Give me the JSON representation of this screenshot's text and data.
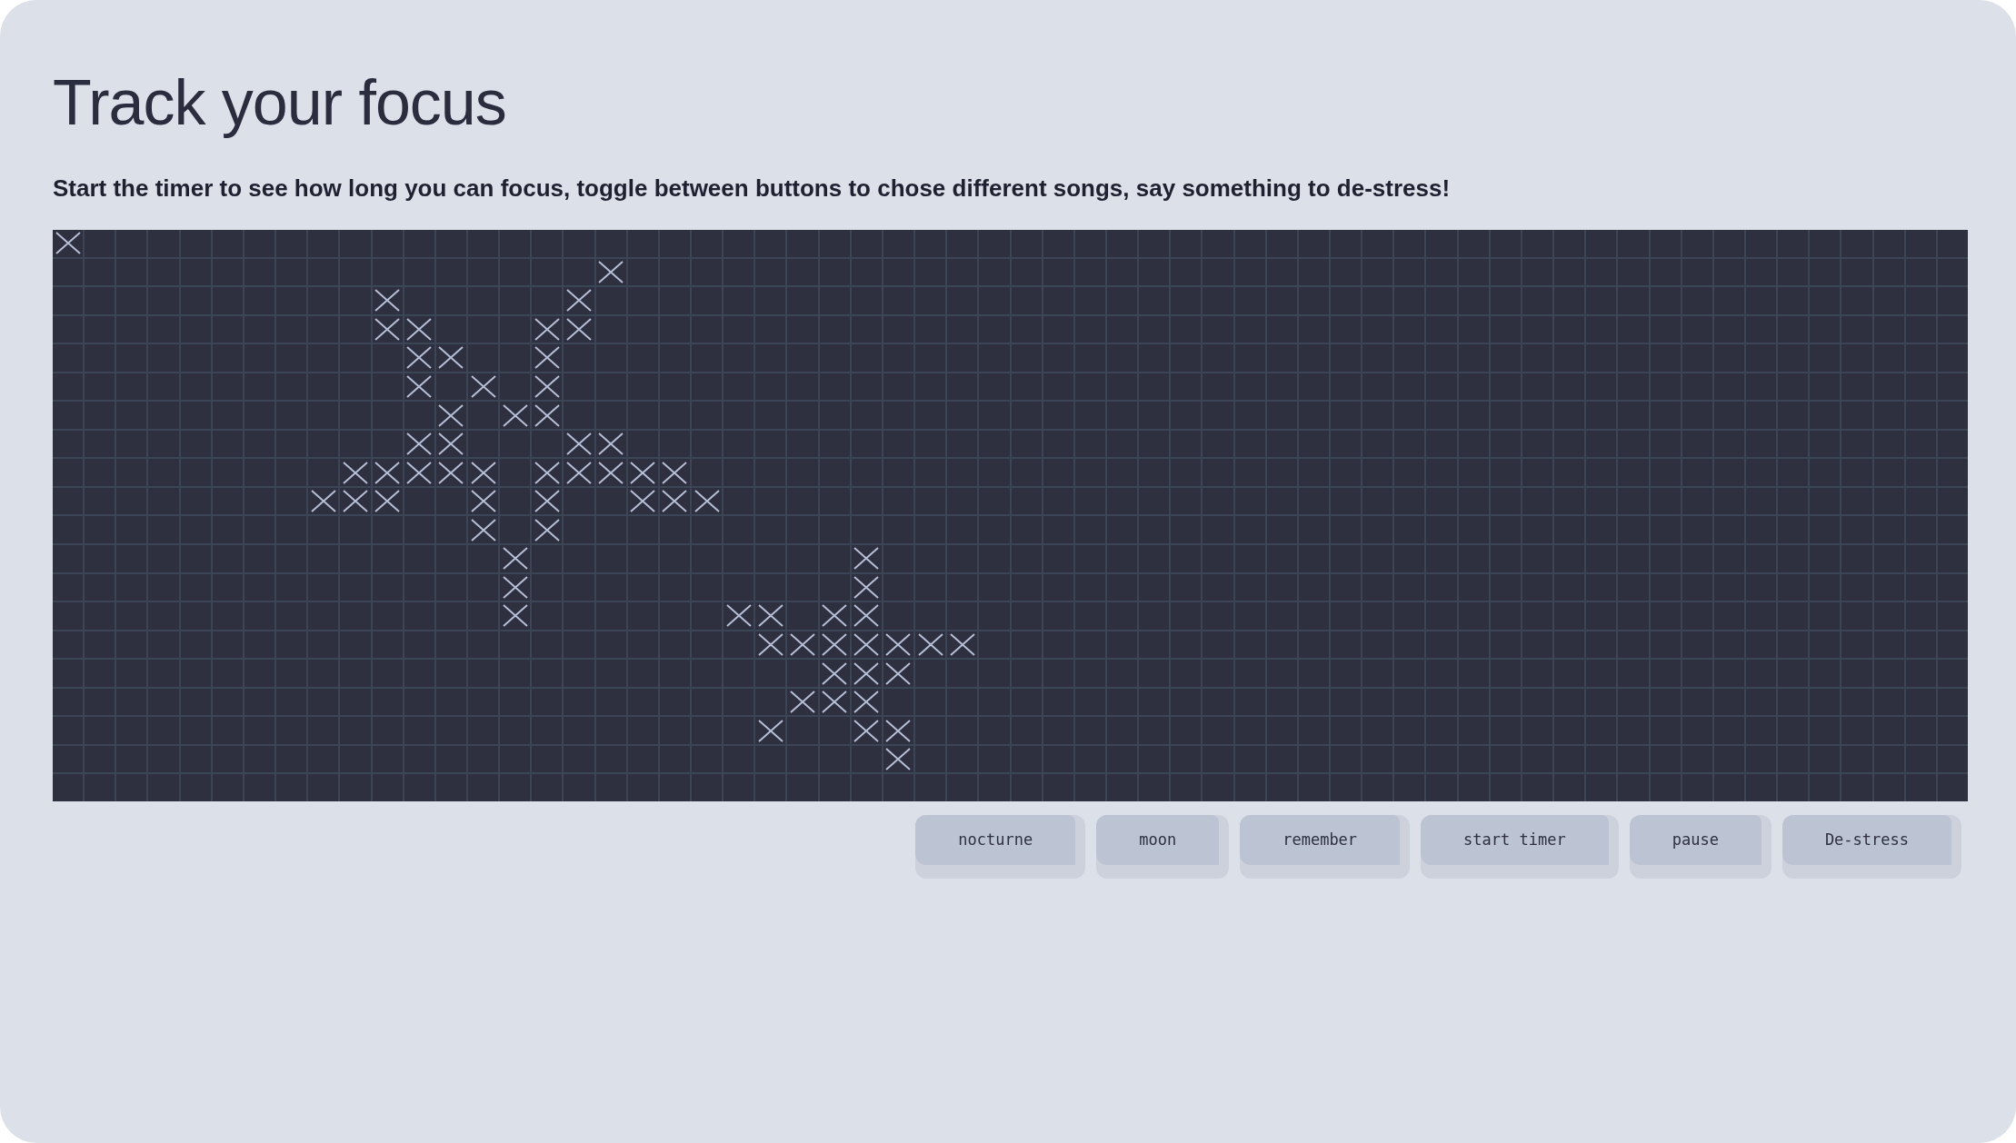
{
  "title": "Track your focus",
  "instructions": "Start the timer to see how long you can focus, toggle between buttons to chose different songs, say something to de-stress!",
  "grid": {
    "rows": [
      {
        "marked": [
          true,
          false,
          false,
          false,
          false,
          false,
          false,
          false,
          false,
          false,
          false,
          false,
          false,
          false,
          false,
          false,
          false,
          false,
          false,
          false,
          false,
          false,
          false,
          false,
          false,
          false,
          false,
          false,
          false,
          false,
          false,
          false,
          false,
          false,
          false,
          false,
          false,
          false,
          false,
          false,
          false,
          false,
          false,
          false,
          false,
          false,
          false,
          false,
          false,
          false,
          false,
          false,
          false,
          false,
          false,
          false,
          false,
          false,
          false,
          false
        ]
      },
      {
        "marked": [
          false,
          false,
          false,
          false,
          false,
          false,
          false,
          false,
          false,
          false,
          false,
          false,
          false,
          false,
          false,
          false,
          false,
          true,
          false,
          false,
          false,
          false,
          false,
          false,
          false,
          false,
          false,
          false,
          false,
          false,
          false,
          false,
          false,
          false,
          false,
          false,
          false,
          false,
          false,
          false,
          false,
          false,
          false,
          false,
          false,
          false,
          false,
          false,
          false,
          false,
          false,
          false,
          false,
          false,
          false,
          false,
          false,
          false,
          false,
          false
        ]
      },
      {
        "marked": [
          false,
          false,
          false,
          false,
          false,
          false,
          false,
          false,
          false,
          false,
          true,
          false,
          false,
          false,
          false,
          false,
          true,
          false,
          false,
          false,
          false,
          false,
          false,
          false,
          false,
          false,
          false,
          false,
          false,
          false,
          false,
          false,
          false,
          false,
          false,
          false,
          false,
          false,
          false,
          false,
          false,
          false,
          false,
          false,
          false,
          false,
          false,
          false,
          false,
          false,
          false,
          false,
          false,
          false,
          false,
          false,
          false,
          false,
          false,
          false
        ]
      },
      {
        "marked": [
          false,
          false,
          false,
          false,
          false,
          false,
          false,
          false,
          false,
          false,
          true,
          true,
          false,
          false,
          false,
          true,
          true,
          false,
          false,
          false,
          false,
          false,
          false,
          false,
          false,
          false,
          false,
          false,
          false,
          false,
          false,
          false,
          false,
          false,
          false,
          false,
          false,
          false,
          false,
          false,
          false,
          false,
          false,
          false,
          false,
          false,
          false,
          false,
          false,
          false,
          false,
          false,
          false,
          false,
          false,
          false,
          false,
          false,
          false,
          false
        ]
      },
      {
        "marked": [
          false,
          false,
          false,
          false,
          false,
          false,
          false,
          false,
          false,
          false,
          false,
          true,
          true,
          false,
          false,
          true,
          false,
          false,
          false,
          false,
          false,
          false,
          false,
          false,
          false,
          false,
          false,
          false,
          false,
          false,
          false,
          false,
          false,
          false,
          false,
          false,
          false,
          false,
          false,
          false,
          false,
          false,
          false,
          false,
          false,
          false,
          false,
          false,
          false,
          false,
          false,
          false,
          false,
          false,
          false,
          false,
          false,
          false,
          false,
          false
        ]
      },
      {
        "marked": [
          false,
          false,
          false,
          false,
          false,
          false,
          false,
          false,
          false,
          false,
          false,
          true,
          false,
          true,
          false,
          true,
          false,
          false,
          false,
          false,
          false,
          false,
          false,
          false,
          false,
          false,
          false,
          false,
          false,
          false,
          false,
          false,
          false,
          false,
          false,
          false,
          false,
          false,
          false,
          false,
          false,
          false,
          false,
          false,
          false,
          false,
          false,
          false,
          false,
          false,
          false,
          false,
          false,
          false,
          false,
          false,
          false,
          false,
          false,
          false
        ]
      },
      {
        "marked": [
          false,
          false,
          false,
          false,
          false,
          false,
          false,
          false,
          false,
          false,
          false,
          false,
          true,
          false,
          true,
          true,
          false,
          false,
          false,
          false,
          false,
          false,
          false,
          false,
          false,
          false,
          false,
          false,
          false,
          false,
          false,
          false,
          false,
          false,
          false,
          false,
          false,
          false,
          false,
          false,
          false,
          false,
          false,
          false,
          false,
          false,
          false,
          false,
          false,
          false,
          false,
          false,
          false,
          false,
          false,
          false,
          false,
          false,
          false,
          false
        ]
      },
      {
        "marked": [
          false,
          false,
          false,
          false,
          false,
          false,
          false,
          false,
          false,
          false,
          false,
          true,
          true,
          false,
          false,
          false,
          true,
          true,
          false,
          false,
          false,
          false,
          false,
          false,
          false,
          false,
          false,
          false,
          false,
          false,
          false,
          false,
          false,
          false,
          false,
          false,
          false,
          false,
          false,
          false,
          false,
          false,
          false,
          false,
          false,
          false,
          false,
          false,
          false,
          false,
          false,
          false,
          false,
          false,
          false,
          false,
          false,
          false,
          false,
          false
        ]
      },
      {
        "marked": [
          false,
          false,
          false,
          false,
          false,
          false,
          false,
          false,
          false,
          true,
          true,
          true,
          true,
          true,
          false,
          true,
          true,
          true,
          true,
          true,
          false,
          false,
          false,
          false,
          false,
          false,
          false,
          false,
          false,
          false,
          false,
          false,
          false,
          false,
          false,
          false,
          false,
          false,
          false,
          false,
          false,
          false,
          false,
          false,
          false,
          false,
          false,
          false,
          false,
          false,
          false,
          false,
          false,
          false,
          false,
          false,
          false,
          false,
          false,
          false
        ]
      },
      {
        "marked": [
          false,
          false,
          false,
          false,
          false,
          false,
          false,
          false,
          true,
          true,
          true,
          false,
          false,
          true,
          false,
          true,
          false,
          false,
          true,
          true,
          true,
          false,
          false,
          false,
          false,
          false,
          false,
          false,
          false,
          false,
          false,
          false,
          false,
          false,
          false,
          false,
          false,
          false,
          false,
          false,
          false,
          false,
          false,
          false,
          false,
          false,
          false,
          false,
          false,
          false,
          false,
          false,
          false,
          false,
          false,
          false,
          false,
          false,
          false,
          false
        ]
      },
      {
        "marked": [
          false,
          false,
          false,
          false,
          false,
          false,
          false,
          false,
          false,
          false,
          false,
          false,
          false,
          true,
          false,
          true,
          false,
          false,
          false,
          false,
          false,
          false,
          false,
          false,
          false,
          false,
          false,
          false,
          false,
          false,
          false,
          false,
          false,
          false,
          false,
          false,
          false,
          false,
          false,
          false,
          false,
          false,
          false,
          false,
          false,
          false,
          false,
          false,
          false,
          false,
          false,
          false,
          false,
          false,
          false,
          false,
          false,
          false,
          false,
          false
        ]
      },
      {
        "marked": [
          false,
          false,
          false,
          false,
          false,
          false,
          false,
          false,
          false,
          false,
          false,
          false,
          false,
          false,
          true,
          false,
          false,
          false,
          false,
          false,
          false,
          false,
          false,
          false,
          false,
          true,
          false,
          false,
          false,
          false,
          false,
          false,
          false,
          false,
          false,
          false,
          false,
          false,
          false,
          false,
          false,
          false,
          false,
          false,
          false,
          false,
          false,
          false,
          false,
          false,
          false,
          false,
          false,
          false,
          false,
          false,
          false,
          false,
          false,
          false
        ]
      },
      {
        "marked": [
          false,
          false,
          false,
          false,
          false,
          false,
          false,
          false,
          false,
          false,
          false,
          false,
          false,
          false,
          true,
          false,
          false,
          false,
          false,
          false,
          false,
          false,
          false,
          false,
          false,
          true,
          false,
          false,
          false,
          false,
          false,
          false,
          false,
          false,
          false,
          false,
          false,
          false,
          false,
          false,
          false,
          false,
          false,
          false,
          false,
          false,
          false,
          false,
          false,
          false,
          false,
          false,
          false,
          false,
          false,
          false,
          false,
          false,
          false,
          false
        ]
      },
      {
        "marked": [
          false,
          false,
          false,
          false,
          false,
          false,
          false,
          false,
          false,
          false,
          false,
          false,
          false,
          false,
          true,
          false,
          false,
          false,
          false,
          false,
          false,
          true,
          true,
          false,
          true,
          true,
          false,
          false,
          false,
          false,
          false,
          false,
          false,
          false,
          false,
          false,
          false,
          false,
          false,
          false,
          false,
          false,
          false,
          false,
          false,
          false,
          false,
          false,
          false,
          false,
          false,
          false,
          false,
          false,
          false,
          false,
          false,
          false,
          false,
          false
        ]
      },
      {
        "marked": [
          false,
          false,
          false,
          false,
          false,
          false,
          false,
          false,
          false,
          false,
          false,
          false,
          false,
          false,
          false,
          false,
          false,
          false,
          false,
          false,
          false,
          false,
          true,
          true,
          true,
          true,
          true,
          true,
          true,
          false,
          false,
          false,
          false,
          false,
          false,
          false,
          false,
          false,
          false,
          false,
          false,
          false,
          false,
          false,
          false,
          false,
          false,
          false,
          false,
          false,
          false,
          false,
          false,
          false,
          false,
          false,
          false,
          false,
          false,
          false
        ]
      },
      {
        "marked": [
          false,
          false,
          false,
          false,
          false,
          false,
          false,
          false,
          false,
          false,
          false,
          false,
          false,
          false,
          false,
          false,
          false,
          false,
          false,
          false,
          false,
          false,
          false,
          false,
          true,
          true,
          true,
          false,
          false,
          false,
          false,
          false,
          false,
          false,
          false,
          false,
          false,
          false,
          false,
          false,
          false,
          false,
          false,
          false,
          false,
          false,
          false,
          false,
          false,
          false,
          false,
          false,
          false,
          false,
          false,
          false,
          false,
          false,
          false,
          false
        ]
      },
      {
        "marked": [
          false,
          false,
          false,
          false,
          false,
          false,
          false,
          false,
          false,
          false,
          false,
          false,
          false,
          false,
          false,
          false,
          false,
          false,
          false,
          false,
          false,
          false,
          false,
          true,
          true,
          true,
          false,
          false,
          false,
          false,
          false,
          false,
          false,
          false,
          false,
          false,
          false,
          false,
          false,
          false,
          false,
          false,
          false,
          false,
          false,
          false,
          false,
          false,
          false,
          false,
          false,
          false,
          false,
          false,
          false,
          false,
          false,
          false,
          false,
          false
        ]
      },
      {
        "marked": [
          false,
          false,
          false,
          false,
          false,
          false,
          false,
          false,
          false,
          false,
          false,
          false,
          false,
          false,
          false,
          false,
          false,
          false,
          false,
          false,
          false,
          false,
          true,
          false,
          false,
          true,
          true,
          false,
          false,
          false,
          false,
          false,
          false,
          false,
          false,
          false,
          false,
          false,
          false,
          false,
          false,
          false,
          false,
          false,
          false,
          false,
          false,
          false,
          false,
          false,
          false,
          false,
          false,
          false,
          false,
          false,
          false,
          false,
          false,
          false
        ]
      },
      {
        "marked": [
          false,
          false,
          false,
          false,
          false,
          false,
          false,
          false,
          false,
          false,
          false,
          false,
          false,
          false,
          false,
          false,
          false,
          false,
          false,
          false,
          false,
          false,
          false,
          false,
          false,
          false,
          true,
          false,
          false,
          false,
          false,
          false,
          false,
          false,
          false,
          false,
          false,
          false,
          false,
          false,
          false,
          false,
          false,
          false,
          false,
          false,
          false,
          false,
          false,
          false,
          false,
          false,
          false,
          false,
          false,
          false,
          false,
          false,
          false,
          false
        ]
      },
      {
        "marked": [
          false,
          false,
          false,
          false,
          false,
          false,
          false,
          false,
          false,
          false,
          false,
          false,
          false,
          false,
          false,
          false,
          false,
          false,
          false,
          false,
          false,
          false,
          false,
          false,
          false,
          false,
          false,
          false,
          false,
          false,
          false,
          false,
          false,
          false,
          false,
          false,
          false,
          false,
          false,
          false,
          false,
          false,
          false,
          false,
          false,
          false,
          false,
          false,
          false,
          false,
          false,
          false,
          false,
          false,
          false,
          false,
          false,
          false,
          false,
          false
        ]
      }
    ]
  },
  "buttons": [
    "nocturne",
    "moon",
    "remember",
    "start timer",
    "pause",
    "De-stress"
  ]
}
